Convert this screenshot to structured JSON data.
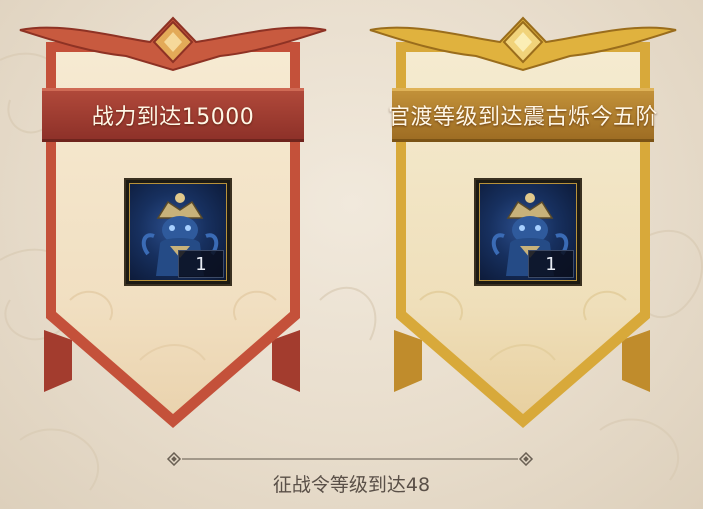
{
  "rewards": [
    {
      "condition": "战力到达15000",
      "theme": "red",
      "item": {
        "icon": "blue-beast-warrior-icon",
        "count": "1"
      }
    },
    {
      "condition": "官渡等级到达震古烁今五阶",
      "theme": "gold",
      "item": {
        "icon": "blue-beast-warrior-icon",
        "count": "1"
      }
    }
  ],
  "footer": {
    "label": "征战令等级到达48"
  },
  "colors": {
    "red_frame": "#c4513a",
    "red_ribbon": "#9a3b31",
    "gold_frame": "#d8a93a",
    "gold_ribbon": "#b27c28",
    "card_fill": "#f4e7cc"
  }
}
